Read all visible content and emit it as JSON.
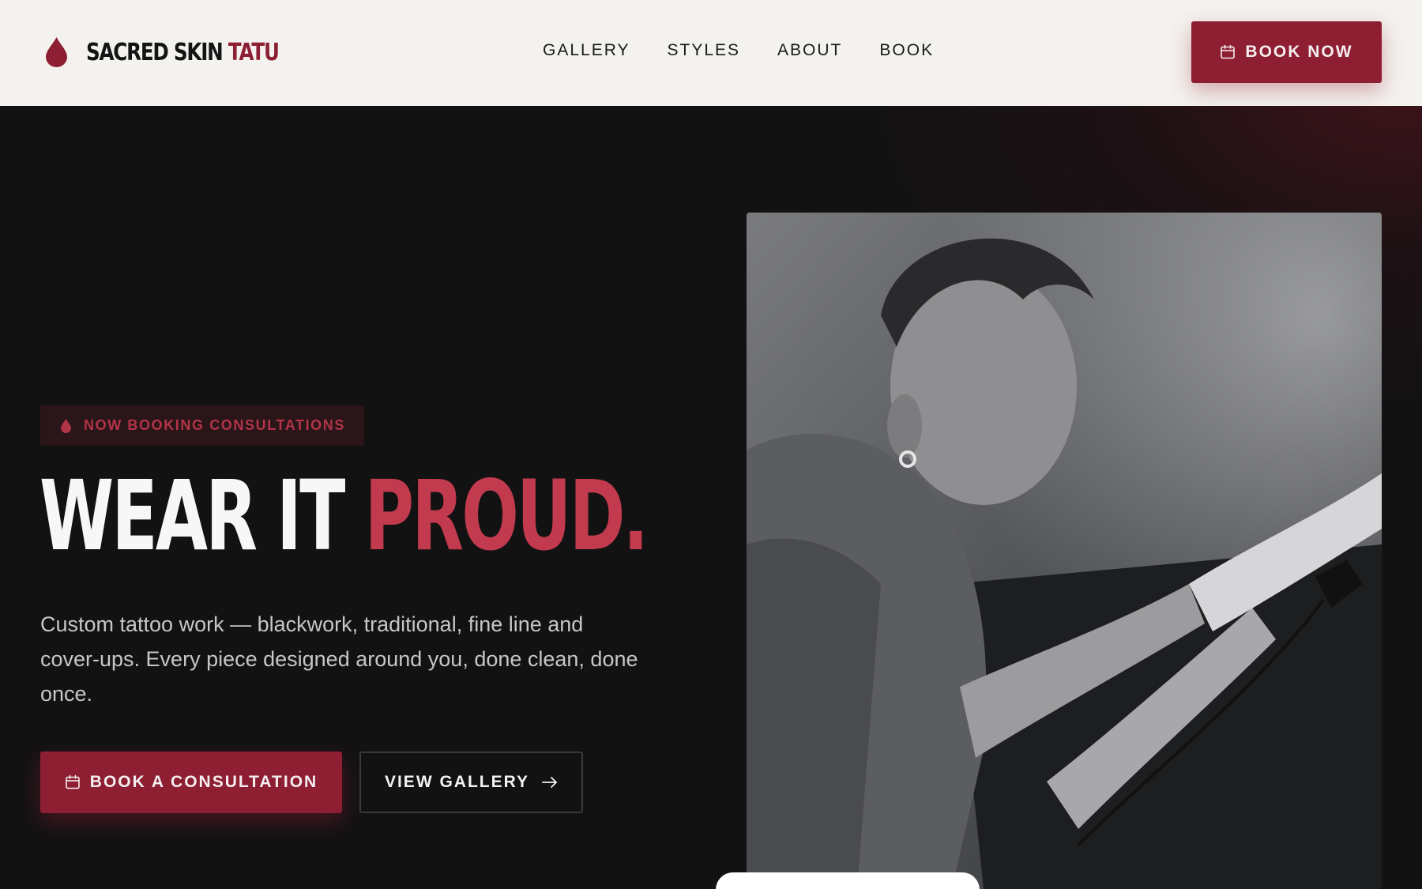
{
  "header": {
    "logo": {
      "name_main": "SACRED SKIN",
      "name_accent": "TATU"
    },
    "nav": [
      {
        "label": "GALLERY"
      },
      {
        "label": "STYLES"
      },
      {
        "label": "ABOUT"
      },
      {
        "label": "BOOK"
      }
    ],
    "cta": {
      "label": "BOOK NOW",
      "icon": "calendar-icon"
    }
  },
  "hero": {
    "badge": {
      "label": "NOW BOOKING CONSULTATIONS",
      "icon": "ink-drop-icon"
    },
    "headline": {
      "main": "WEAR IT",
      "accent": "PROUD."
    },
    "subcopy": "Custom tattoo work — blackwork, traditional, fine line and cover-ups. Every piece designed around you, done clean, done once.",
    "primary_button": {
      "label": "BOOK A CONSULTATION",
      "icon": "calendar-icon"
    },
    "secondary_button": {
      "label": "VIEW GALLERY",
      "icon": "arrow-right-icon"
    },
    "image": {
      "subject": "tattoo artist working on a client's forearm, black and white photo"
    }
  },
  "colors": {
    "brand_red": "#8e1f33",
    "accent_red": "#c23a4d",
    "header_bg": "#f4f2ee",
    "hero_bg": "#121213"
  }
}
